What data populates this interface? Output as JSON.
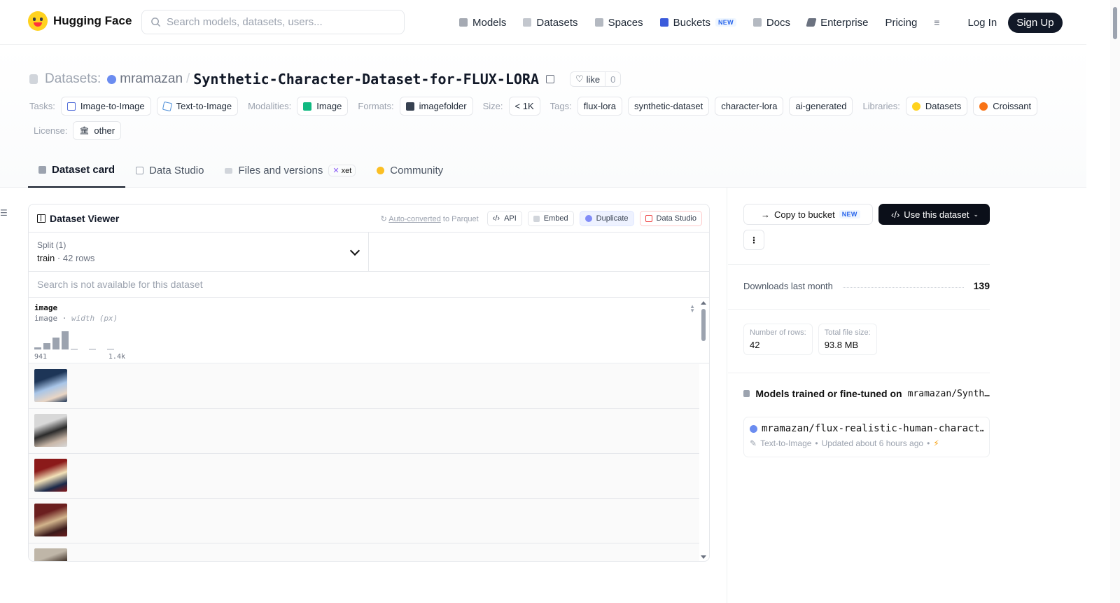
{
  "header": {
    "brand": "Hugging Face",
    "search_placeholder": "Search models, datasets, users...",
    "nav": [
      {
        "label": "Models",
        "icon": "cube-icon"
      },
      {
        "label": "Datasets",
        "icon": "database-icon"
      },
      {
        "label": "Spaces",
        "icon": "grid-icon"
      },
      {
        "label": "Buckets",
        "icon": "bucket-icon",
        "badge": "NEW"
      },
      {
        "label": "Docs",
        "icon": "book-icon"
      },
      {
        "label": "Enterprise",
        "icon": "enterprise-icon"
      },
      {
        "label": "Pricing"
      }
    ],
    "menu_icon": "≡",
    "login": "Log In",
    "signup": "Sign Up"
  },
  "repo": {
    "prefix": "Datasets:",
    "user": "mramazan",
    "separator": "/",
    "name": "Synthetic-Character-Dataset-for-FLUX-LORA",
    "like_label": "like",
    "like_count": "0"
  },
  "tags": {
    "tasks_label": "Tasks:",
    "tasks": [
      "Image-to-Image",
      "Text-to-Image"
    ],
    "modalities_label": "Modalities:",
    "modalities": [
      "Image"
    ],
    "formats_label": "Formats:",
    "formats": [
      "imagefolder"
    ],
    "size_label": "Size:",
    "size": "< 1K",
    "tags_label": "Tags:",
    "tags": [
      "flux-lora",
      "synthetic-dataset",
      "character-lora",
      "ai-generated"
    ],
    "libraries_label": "Libraries:",
    "libraries": [
      "Datasets",
      "Croissant"
    ],
    "license_label": "License:",
    "license": "other"
  },
  "tabs": [
    {
      "label": "Dataset card",
      "active": true
    },
    {
      "label": "Data Studio"
    },
    {
      "label": "Files and versions",
      "badge": "xet"
    },
    {
      "label": "Community"
    }
  ],
  "viewer": {
    "title": "Dataset Viewer",
    "auto_converted_link": "Auto-converted",
    "auto_converted_rest": " to Parquet",
    "buttons": {
      "api": "API",
      "embed": "Embed",
      "duplicate": "Duplicate",
      "data_studio": "Data Studio"
    },
    "split_label": "Split (1)",
    "split_name": "train",
    "split_dot": "·",
    "split_rows": "42 rows",
    "search_na": "Search is not available for this dataset",
    "column": {
      "name": "image",
      "type": "image",
      "type_dot": " · ",
      "type_detail": "width (px)",
      "hist_min": "941",
      "hist_max": "1.4k",
      "histogram": [
        0.1,
        0.35,
        0.65,
        1.0,
        0.05,
        0,
        0.05,
        0,
        0.05
      ]
    },
    "thumb_colors": [
      [
        "#1d3557",
        "#a8c5e8",
        "#e9d5c4"
      ],
      [
        "#d8d8d8",
        "#2b2b2b",
        "#c9b7a8"
      ],
      [
        "#8b1a1a",
        "#f2e1b8",
        "#1b2a4a"
      ],
      [
        "#6b1f1f",
        "#d2b48c",
        "#3b1a1a"
      ],
      [
        "#bfb6a8",
        "#3d2f26",
        "#e0c9b0"
      ]
    ]
  },
  "sidebar": {
    "copy_bucket": "Copy to bucket",
    "copy_bucket_badge": "NEW",
    "use_dataset": "Use this dataset",
    "kebab": "⋮",
    "downloads_label": "Downloads last month",
    "downloads_value": "139",
    "rows_label": "Number of rows:",
    "rows_value": "42",
    "size_label": "Total file size:",
    "size_value": "93.8 MB",
    "models_heading": "Models trained or fine-tuned on",
    "models_heading_repo": "mramazan/Synth…",
    "model": {
      "name": "mramazan/flux-realistic-human-charact…",
      "task": "Text-to-Image",
      "dot": "•",
      "updated": "Updated about 6 hours ago",
      "bolt": "⚡"
    }
  }
}
